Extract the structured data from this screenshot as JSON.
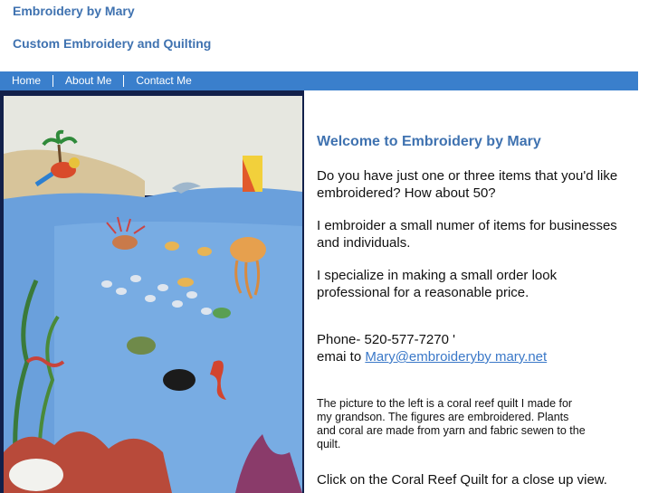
{
  "header": {
    "site_title": "Embroidery by Mary",
    "tagline": "Custom Embroidery and Quilting"
  },
  "nav": {
    "items": [
      {
        "label": "Home"
      },
      {
        "label": "About Me"
      },
      {
        "label": "Contact Me"
      }
    ]
  },
  "colors": {
    "brand_text": "#3f72b0",
    "nav_bar": "#3a7fcc",
    "link": "#3a78c8"
  },
  "main": {
    "image_alt_subject": "coral-reef-quilt-image",
    "welcome_heading": "Welcome to Embroidery by Mary",
    "paragraph_1": "Do you have just one or three items that you'd like embroidered?  How about 50?",
    "paragraph_2": "I embroider a small numer of items for businesses and individuals.",
    "paragraph_3": "I specialize in making a small order look professional for a reasonable price.",
    "phone_line": "Phone- 520-577-7270 '",
    "email_prefix": "emai to ",
    "email_link": "Mary@embroideryby mary.net",
    "description": "The picture to the left is a coral reef quilt I made for my grandson. The figures are embroidered. Plants and coral are made from yarn and fabric sewen to the quilt.",
    "closeup_text": "Click on the Coral Reef Quilt for a close up view."
  }
}
